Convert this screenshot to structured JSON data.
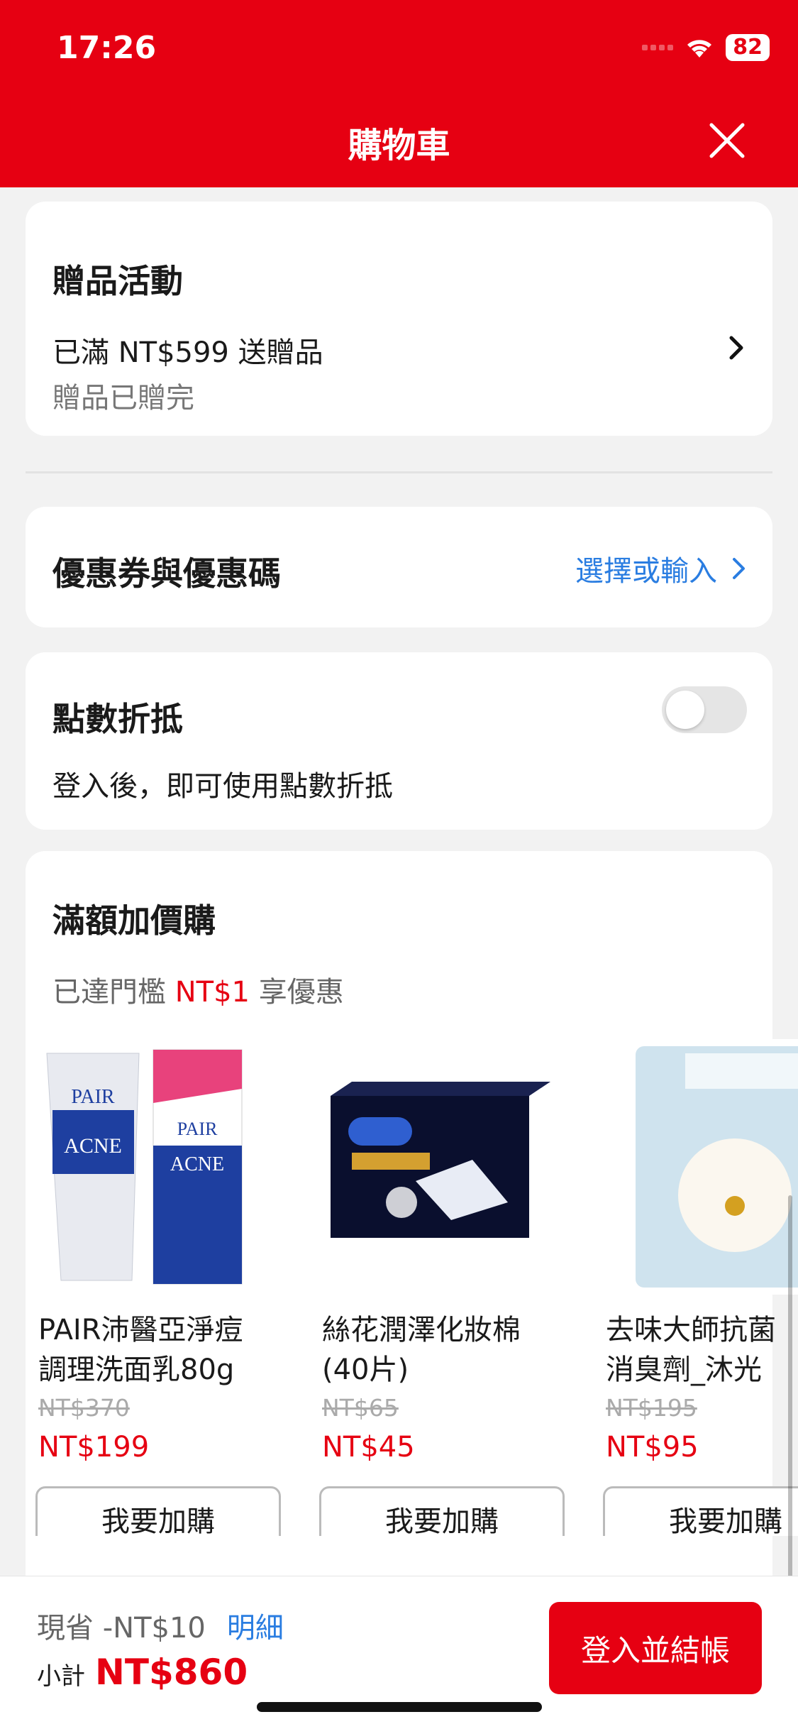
{
  "status": {
    "time": "17:26",
    "battery": "82"
  },
  "header": {
    "title": "購物車"
  },
  "gift": {
    "title": "贈品活動",
    "line1": "已滿 NT$599 送贈品",
    "line2": "贈品已贈完"
  },
  "coupon": {
    "title": "優惠券與優惠碼",
    "action": "選擇或輸入"
  },
  "points": {
    "title": "點數折抵",
    "desc": "登入後，即可使用點數折抵",
    "toggle_on": false
  },
  "addon": {
    "title": "滿額加價購",
    "sub_prefix": "已達門檻 ",
    "sub_amount": "NT$1",
    "sub_suffix": " 享優惠",
    "products": [
      {
        "name1": "PAIR沛醫亞淨痘",
        "name2": "調理洗面乳80g",
        "orig": "NT$370",
        "price": "NT$199",
        "button": "我要加購"
      },
      {
        "name1": "絲花潤澤化妝棉",
        "name2": "(40片)",
        "orig": "NT$65",
        "price": "NT$45",
        "button": "我要加購"
      },
      {
        "name1": "去味大師抗菌",
        "name2": "消臭劑_沐光",
        "orig": "NT$195",
        "price": "NT$95",
        "button": "我要加購"
      }
    ]
  },
  "footer": {
    "saved": "現省 -NT$10",
    "detail": "明細",
    "subtotal_label": "小計",
    "subtotal": "NT$860",
    "checkout": "登入並結帳"
  },
  "colors": {
    "brand": "#e60012",
    "link": "#2a7de1"
  }
}
